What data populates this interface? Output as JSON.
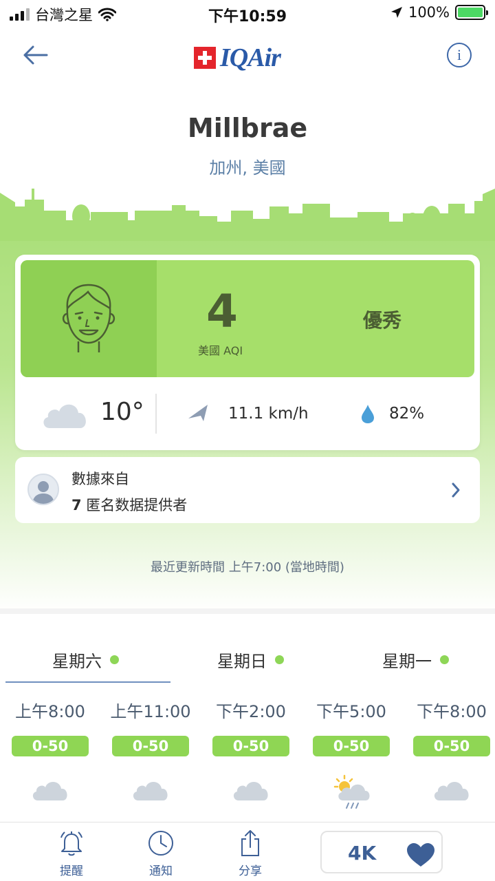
{
  "status_bar": {
    "carrier": "台灣之星",
    "time": "下午10:59",
    "battery": "100%"
  },
  "header": {
    "logo_text": "IQAir"
  },
  "city": {
    "name": "Millbrae",
    "region": "加州, 美國"
  },
  "aqi": {
    "value": "4",
    "label": "美國 AQI",
    "status": "優秀",
    "color": "#a6df6a"
  },
  "weather": {
    "temperature": "10°",
    "wind": "11.1 km/h",
    "humidity": "82%"
  },
  "source": {
    "title": "數據來自",
    "count": "7",
    "provider_text": " 匿名数据提供者"
  },
  "updated": "最近更新時間 上午7:00 (當地時間)",
  "tabs": [
    {
      "label": "星期六"
    },
    {
      "label": "星期日"
    },
    {
      "label": "星期一"
    }
  ],
  "hourly": [
    {
      "time": "上午8:00",
      "range": "0-50",
      "icon": "cloud-icon"
    },
    {
      "time": "上午11:00",
      "range": "0-50",
      "icon": "cloud-icon"
    },
    {
      "time": "下午2:00",
      "range": "0-50",
      "icon": "cloud-icon"
    },
    {
      "time": "下午5:00",
      "range": "0-50",
      "icon": "sun-rain-icon"
    },
    {
      "time": "下午8:00",
      "range": "0-50",
      "icon": "cloud-icon"
    }
  ],
  "nav": {
    "alerts": "提醒",
    "notifications": "通知",
    "share": "分享",
    "favorites_count": "4K"
  },
  "colors": {
    "accent": "#3d5f96",
    "good": "#8fd654"
  }
}
